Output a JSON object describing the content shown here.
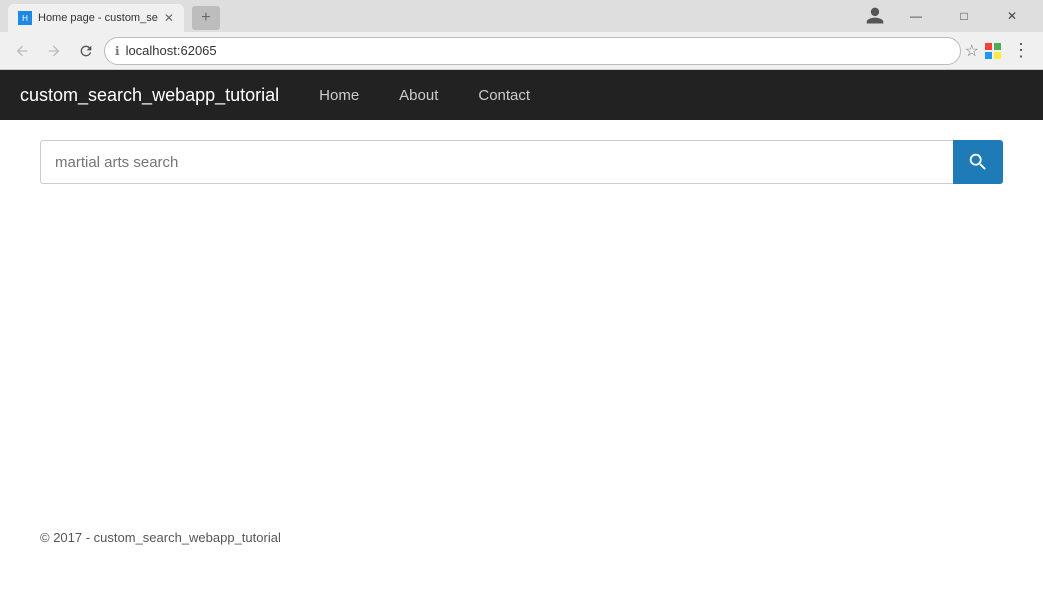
{
  "browser": {
    "tab": {
      "title": "Home page - custom_se",
      "favicon_label": "H"
    },
    "address": "localhost:62065",
    "address_icon": "ℹ",
    "profile_icon": "👤",
    "new_tab_label": "+"
  },
  "navbar": {
    "brand": "custom_search_webapp_tutorial",
    "links": [
      {
        "label": "Home",
        "id": "home"
      },
      {
        "label": "About",
        "id": "about"
      },
      {
        "label": "Contact",
        "id": "contact"
      }
    ]
  },
  "search": {
    "placeholder": "martial arts search",
    "button_icon": "🔍"
  },
  "footer": {
    "text": "© 2017 - custom_search_webapp_tutorial"
  },
  "window_buttons": {
    "minimize": "—",
    "maximize": "□",
    "close": "✕"
  }
}
